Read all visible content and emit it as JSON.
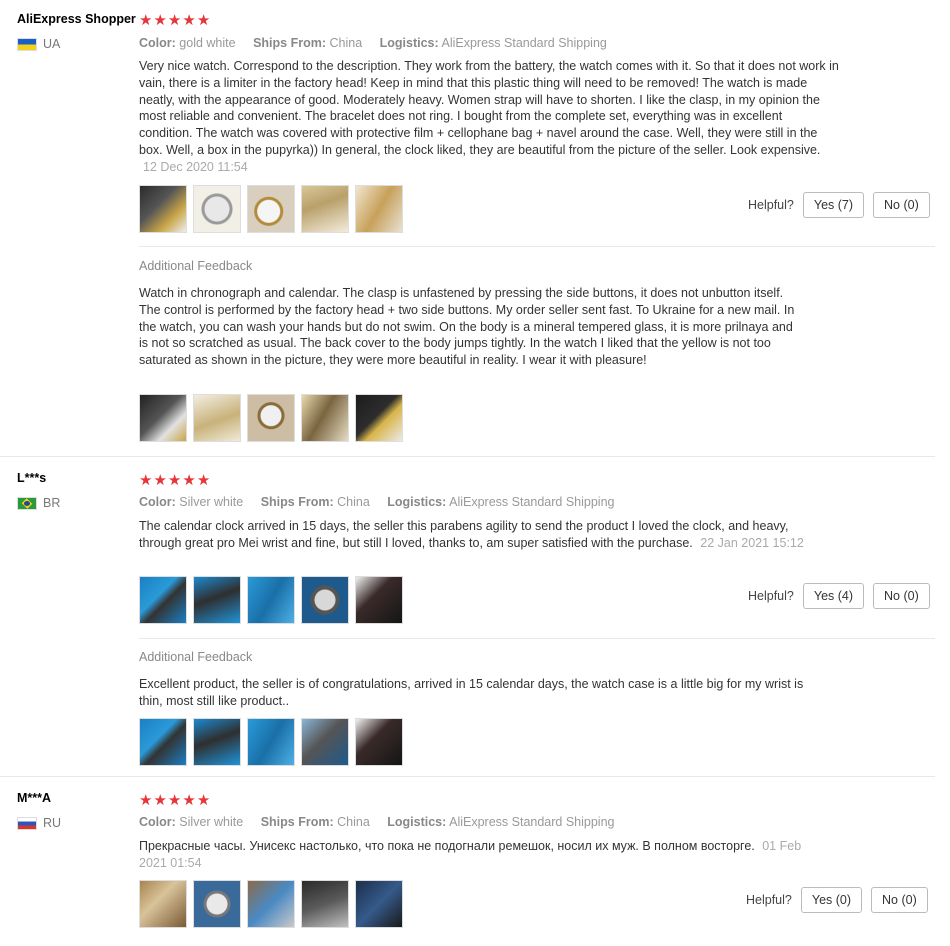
{
  "reviews": [
    {
      "user": "AliExpress Shopper",
      "country": "UA",
      "stars": [
        "★",
        "★",
        "★",
        "★",
        "★"
      ],
      "color_label": "Color:",
      "color": "gold white",
      "ships_label": "Ships From:",
      "ships": "China",
      "logistics_label": "Logistics:",
      "logistics": "AliExpress Standard Shipping",
      "text": "Very nice watch. Correspond to the description. They work from the battery, the watch comes with it. So that it does not work in vain, there is a limiter in the factory head! Keep in mind that this plastic thing will need to be removed! The watch is made neatly, with the appearance of good. Moderately heavy. Women strap will have to shorten. I like the clasp, in my opinion the most reliable and convenient. The bracelet does not ring. I bought from the complete set, everything was in excellent condition. The watch was covered with protective film + cellophane bag + navel around the case. Well, they were still in the box. Well, a box in the pupyrka)) In general, the clock liked, they are beautiful from the picture of the seller. Look expensive.",
      "date": "12 Dec 2020 11:54",
      "helpful_label": "Helpful?",
      "yes": "Yes (7)",
      "no": "No (0)",
      "additional_label": "Additional Feedback",
      "additional_text": "Watch in chronograph and calendar. The clasp is unfastened by pressing the side buttons, it does not unbutton itself. The control is performed by the factory head + two side buttons. My order seller sent fast. To Ukraine for a new mail. In the watch, you can wash your hands but do not swim. On the body is a mineral tempered glass, it is more prilnaya and is not so scratched as usual. The back cover to the body jumps tightly. In the watch I liked that the yellow is not too saturated as shown in the picture, they were more beautiful in reality. I wear it with pleasure!"
    },
    {
      "user": "L***s",
      "country": "BR",
      "stars": [
        "★",
        "★",
        "★",
        "★",
        "★"
      ],
      "color_label": "Color:",
      "color": "Silver white",
      "ships_label": "Ships From:",
      "ships": "China",
      "logistics_label": "Logistics:",
      "logistics": "AliExpress Standard Shipping",
      "text": "The calendar clock arrived in 15 days, the seller this parabens agility to send the product I loved the clock, and heavy, through great pro Mei wrist and fine, but still I loved, thanks to, am super satisfied with the purchase.",
      "date": "22 Jan 2021 15:12",
      "helpful_label": "Helpful?",
      "yes": "Yes (4)",
      "no": "No (0)",
      "additional_label": "Additional Feedback",
      "additional_text": "Excellent product, the seller is of congratulations, arrived in 15 calendar days, the watch case is a little big for my wrist is thin, most still like product.."
    },
    {
      "user": "M***A",
      "country": "RU",
      "stars": [
        "★",
        "★",
        "★",
        "★",
        "★"
      ],
      "color_label": "Color:",
      "color": "Silver white",
      "ships_label": "Ships From:",
      "ships": "China",
      "logistics_label": "Logistics:",
      "logistics": "AliExpress Standard Shipping",
      "text": "Прекрасные часы. Унисекс настолько, что пока не подогнали ремешок, носил их муж. В полном восторге.",
      "date": "01 Feb 2021 01:54",
      "helpful_label": "Helpful?",
      "yes": "Yes (0)",
      "no": "No (0)"
    }
  ],
  "colors": {
    "star": "#e5373a",
    "muted": "#999999",
    "border": "#e8e8e8"
  }
}
